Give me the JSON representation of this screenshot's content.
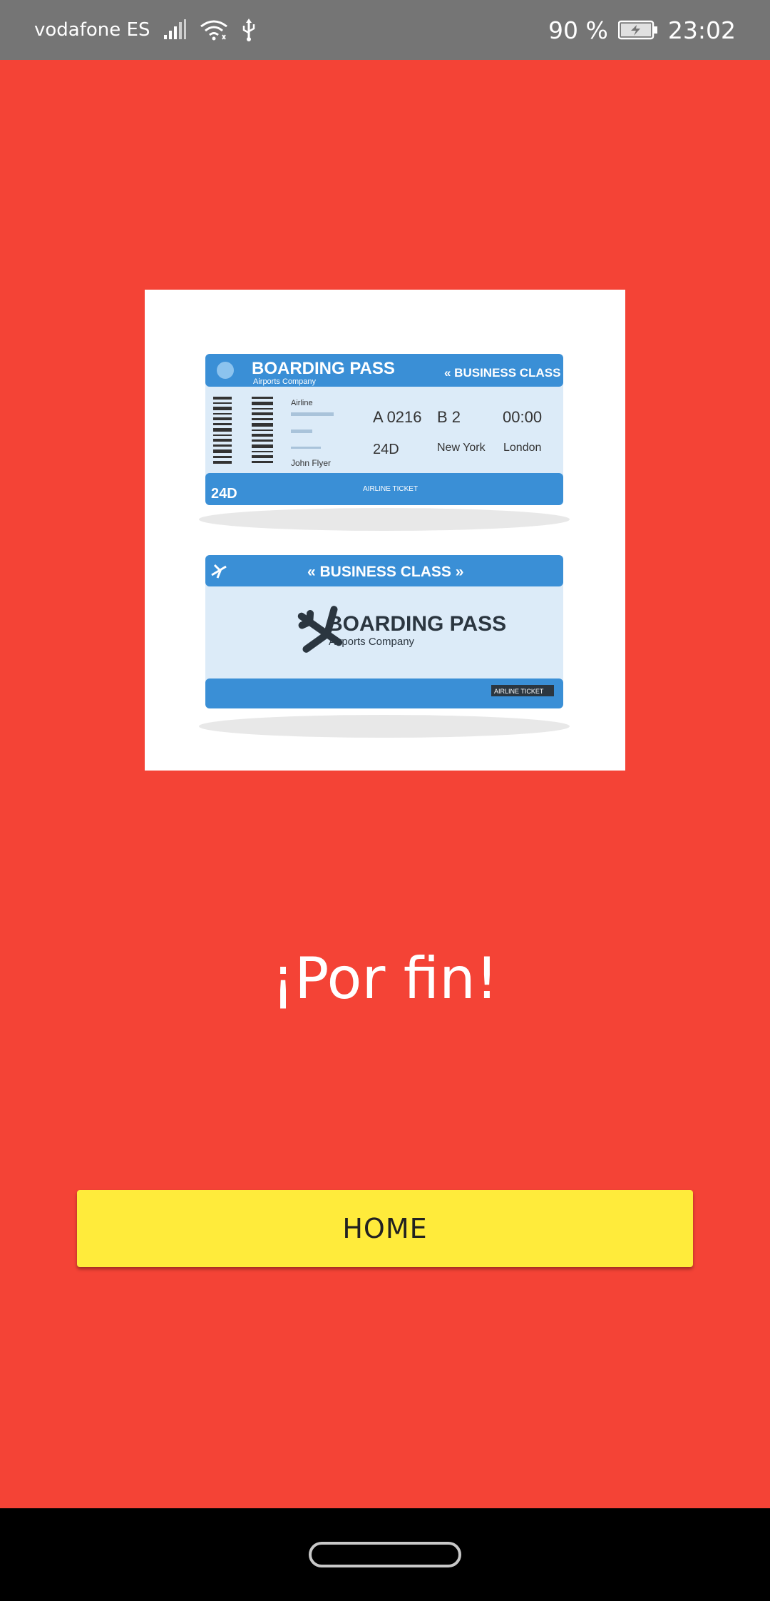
{
  "status_bar": {
    "carrier": "vodafone ES",
    "battery_percent": "90 %",
    "time": "23:02",
    "icons": [
      "signal-icon",
      "wifi-icon",
      "usb-icon",
      "battery-charging-icon"
    ]
  },
  "image": {
    "ticket_top": {
      "title": "BOARDING PASS",
      "company": "Airports Company",
      "class": "« BUSINESS CLASS",
      "airline_label": "Airline",
      "flight": "A 0216",
      "gate": "B 2",
      "time": "00:00",
      "seat": "24D",
      "from": "New York",
      "to": "London",
      "passenger": "John Flyer",
      "footer_seat": "24D",
      "footer_label": "AIRLINE TICKET"
    },
    "ticket_bottom": {
      "class": "« BUSINESS CLASS »",
      "title": "BOARDING PASS",
      "company": "Airports Company",
      "footer_label": "AIRLINE TICKET"
    }
  },
  "headline": "¡Por fin!",
  "home_button": {
    "label": "HOME"
  },
  "colors": {
    "background": "#f44336",
    "status_bar": "#757575",
    "button": "#ffeb3b",
    "ticket_blue": "#3a8fd6",
    "ticket_light": "#dcebf8"
  }
}
